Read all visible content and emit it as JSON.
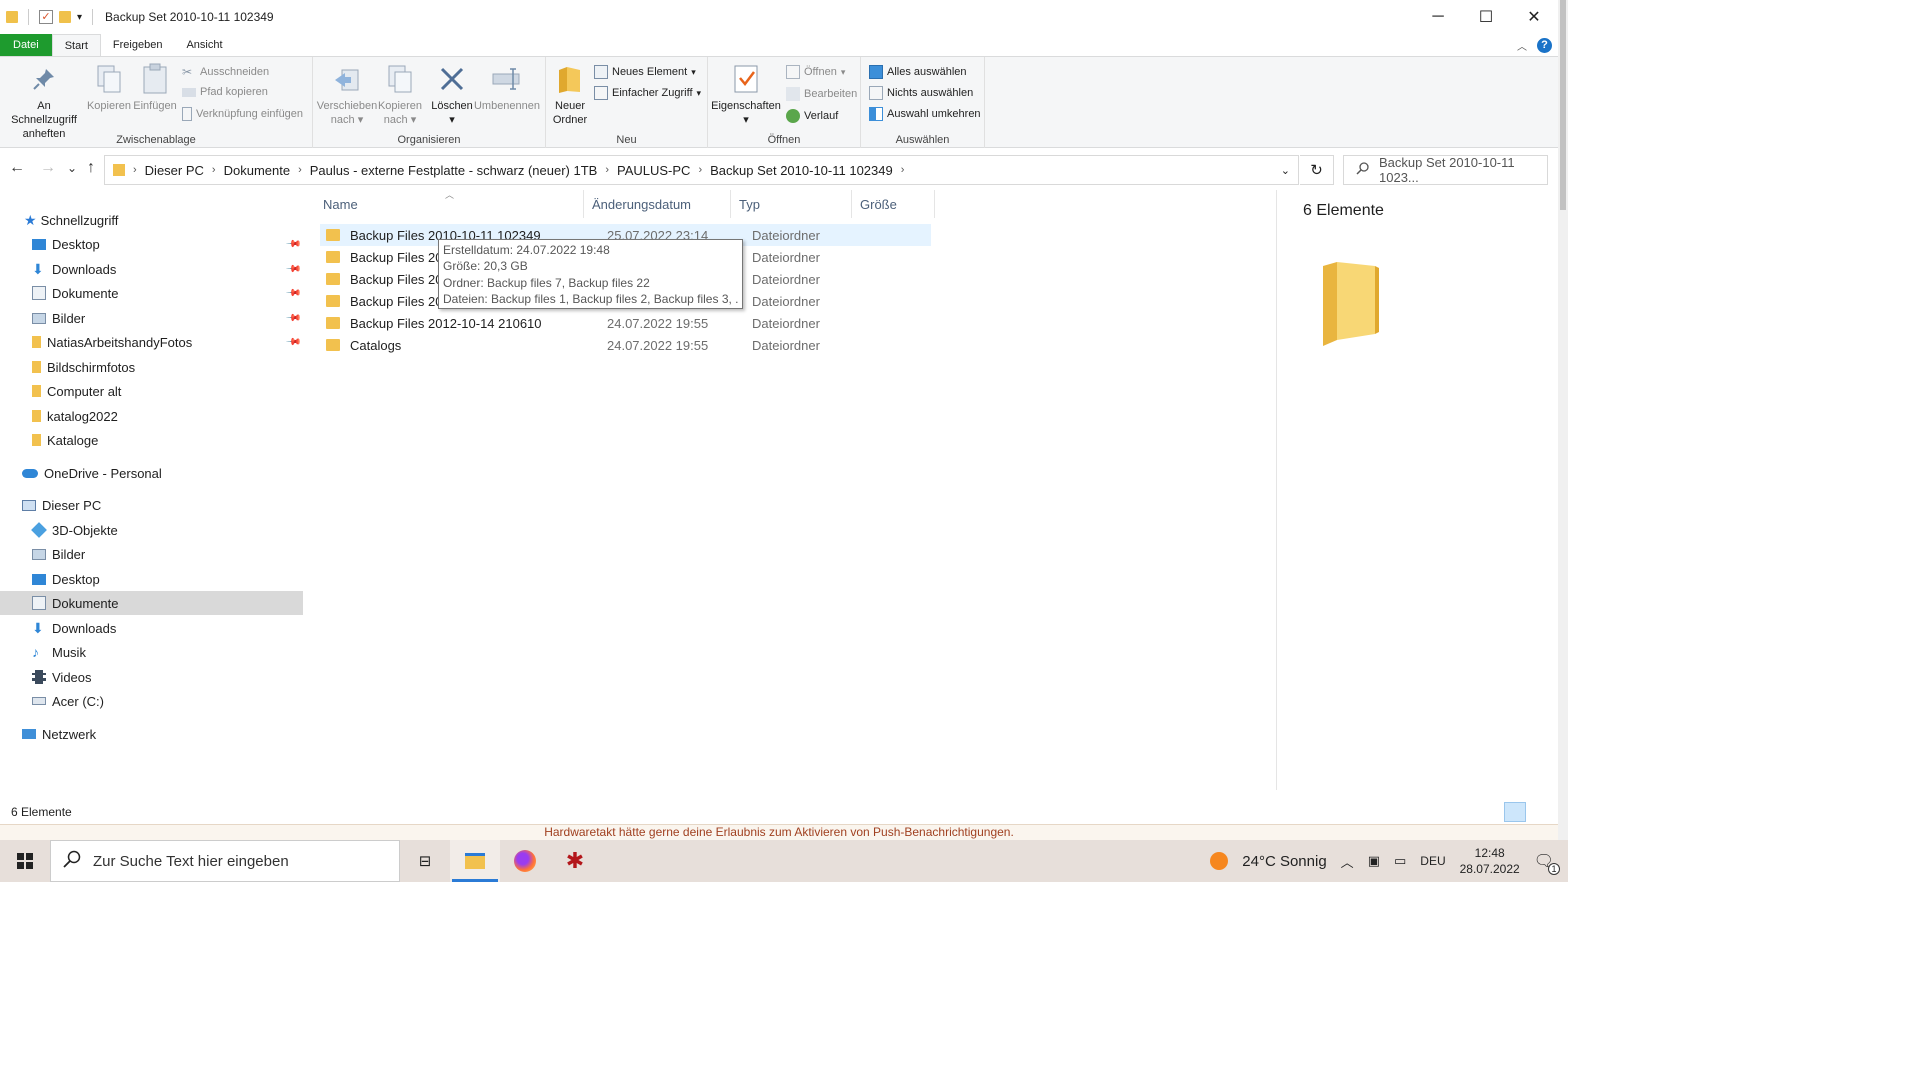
{
  "titlebar": {
    "title": "Backup Set 2010-10-11 102349",
    "minimize_glyph": "─",
    "maximize_glyph": "☐",
    "close_glyph": "✕",
    "qat_dropdown_glyph": "▾"
  },
  "tabs": {
    "file": "Datei",
    "start": "Start",
    "share": "Freigeben",
    "view": "Ansicht"
  },
  "ribbon": {
    "clipboard": {
      "label": "Zwischenablage",
      "pin_line1": "An Schnellzugriff",
      "pin_line2": "anheften",
      "copy": "Kopieren",
      "paste": "Einfügen",
      "cut": "Ausschneiden",
      "copy_path": "Pfad kopieren",
      "paste_link": "Verknüpfung einfügen"
    },
    "organize": {
      "label": "Organisieren",
      "move_line1": "Verschieben",
      "move_line2": "nach",
      "copyto_line1": "Kopieren",
      "copyto_line2": "nach",
      "delete": "Löschen",
      "rename": "Umbenennen"
    },
    "new": {
      "label": "Neu",
      "new_folder_line1": "Neuer",
      "new_folder_line2": "Ordner",
      "new_item": "Neues Element",
      "easy_access": "Einfacher Zugriff"
    },
    "open": {
      "label": "Öffnen",
      "properties": "Eigenschaften",
      "open": "Öffnen",
      "edit": "Bearbeiten",
      "history": "Verlauf"
    },
    "select": {
      "label": "Auswählen",
      "select_all": "Alles auswählen",
      "select_none": "Nichts auswählen",
      "invert": "Auswahl umkehren"
    }
  },
  "address": {
    "back": "←",
    "forward": "→",
    "recent": "⌄",
    "up": "↑",
    "crumbs": [
      "Dieser PC",
      "Dokumente",
      "Paulus - externe Festplatte - schwarz (neuer) 1TB",
      "PAULUS-PC",
      "Backup Set 2010-10-11 102349"
    ],
    "crumb_sep": "›",
    "dropdown": "⌄",
    "refresh": "↻",
    "search_placeholder": "Backup Set 2010-10-11 1023..."
  },
  "nav": {
    "quick_access": "Schnellzugriff",
    "quick_items": [
      "Desktop",
      "Downloads",
      "Dokumente",
      "Bilder",
      "NatiasArbeitshandyFotos",
      "Bildschirmfotos",
      "Computer alt",
      "katalog2022",
      "Kataloge"
    ],
    "onedrive": "OneDrive - Personal",
    "this_pc": "Dieser PC",
    "pc_items": [
      "3D-Objekte",
      "Bilder",
      "Desktop",
      "Dokumente",
      "Downloads",
      "Musik",
      "Videos",
      "Acer (C:)"
    ],
    "network": "Netzwerk",
    "pin_glyph": "📌"
  },
  "columns": {
    "name": "Name",
    "date": "Änderungsdatum",
    "type": "Typ",
    "size": "Größe"
  },
  "files": [
    {
      "name": "Backup Files 2010-10-11 102349",
      "date": "25.07.2022 23:14",
      "type": "Dateiordner"
    },
    {
      "name": "Backup Files 2010",
      "date": "",
      "type": "Dateiordner"
    },
    {
      "name": "Backup Files 2012",
      "date": "",
      "type": "Dateiordner"
    },
    {
      "name": "Backup Files 2012",
      "date": "",
      "type": "Dateiordner"
    },
    {
      "name": "Backup Files 2012-10-14 210610",
      "date": "24.07.2022 19:55",
      "type": "Dateiordner"
    },
    {
      "name": "Catalogs",
      "date": "24.07.2022 19:55",
      "type": "Dateiordner"
    }
  ],
  "tooltip": {
    "created": "Erstelldatum: 24.07.2022 19:48",
    "size": "Größe: 20,3 GB",
    "folders": "Ordner: Backup files 7, Backup files 22",
    "files": "Dateien: Backup files 1, Backup files 2, Backup files 3, ..."
  },
  "details": {
    "count": "6 Elemente"
  },
  "status": {
    "count": "6 Elemente"
  },
  "behind_text": "Hardwaretakt hätte gerne deine Erlaubnis zum Aktivieren von Push-Benachrichtigungen.",
  "taskbar": {
    "search_placeholder": "Zur Suche Text hier eingeben",
    "weather": "24°C  Sonnig",
    "lang": "DEU",
    "time": "12:48",
    "date": "28.07.2022",
    "notif_count": "1"
  },
  "colors": {
    "file_tab": "#1e9b2e",
    "folder": "#f2c14e",
    "accent": "#2b7bd6"
  }
}
